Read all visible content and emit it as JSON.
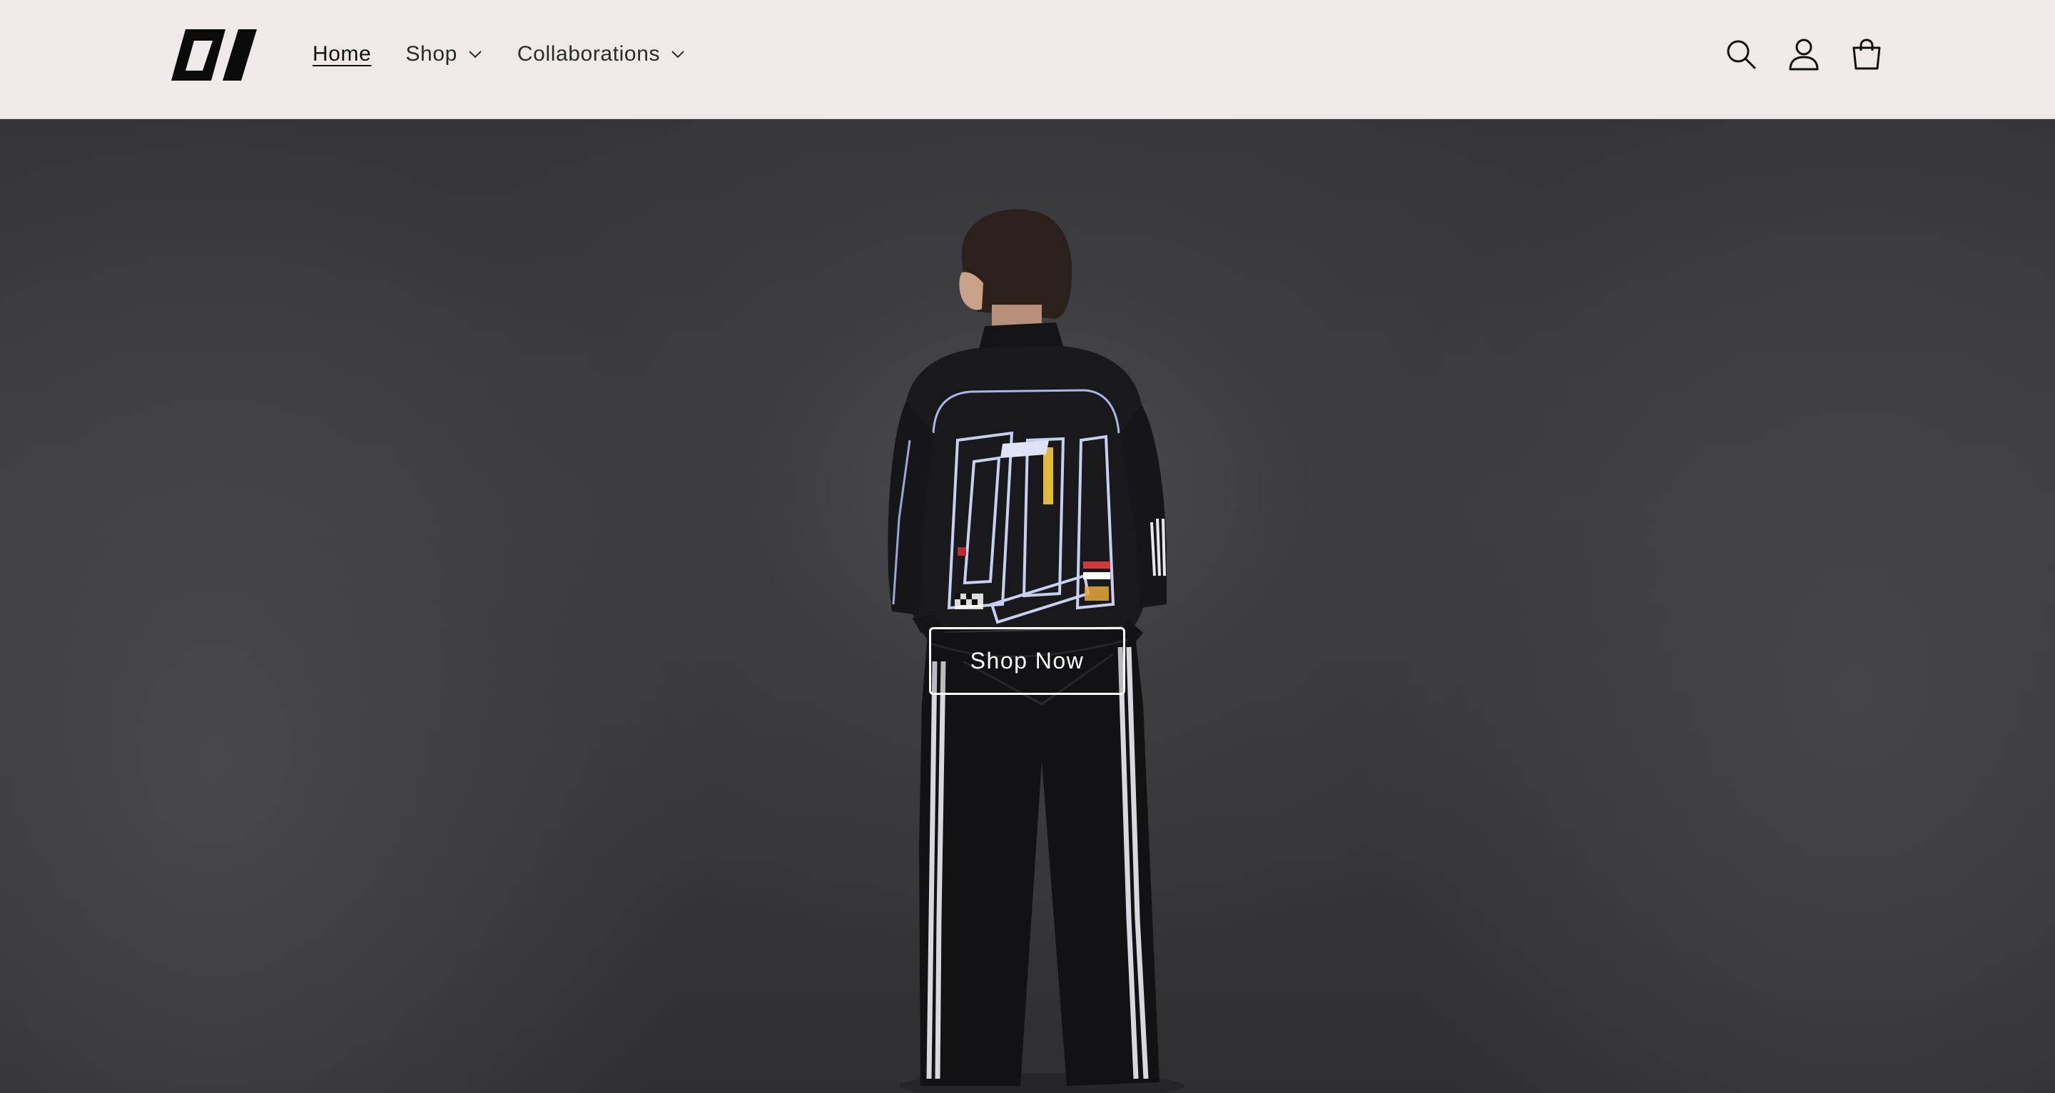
{
  "header": {
    "logo_text": "01",
    "nav": [
      {
        "label": "Home",
        "active": true,
        "has_dropdown": false
      },
      {
        "label": "Shop",
        "active": false,
        "has_dropdown": true
      },
      {
        "label": "Collaborations",
        "active": false,
        "has_dropdown": true
      }
    ],
    "icons": [
      "search-icon",
      "account-icon",
      "cart-icon"
    ]
  },
  "hero": {
    "button_label": "Shop Now",
    "image_description_icon": "model-photo"
  },
  "colors": {
    "header_bg": "#efe9e9",
    "hero_bg": "#3c3c40",
    "button_border": "#ffffff",
    "text": "#2a2a2a"
  }
}
